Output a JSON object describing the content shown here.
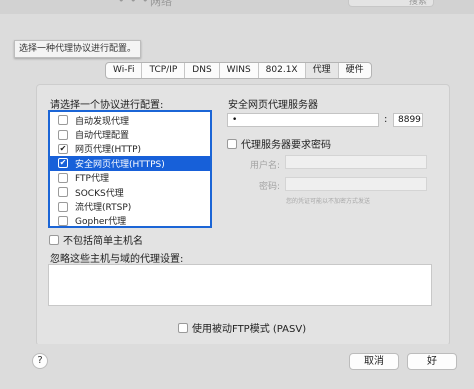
{
  "window": {
    "title_partial": "网络",
    "search_partial": "搜索"
  },
  "tooltip": "选择一种代理协议进行配置。",
  "tabs": [
    {
      "label": "Wi-Fi",
      "selected": false
    },
    {
      "label": "TCP/IP",
      "selected": false
    },
    {
      "label": "DNS",
      "selected": false
    },
    {
      "label": "WINS",
      "selected": false
    },
    {
      "label": "802.1X",
      "selected": false
    },
    {
      "label": "代理",
      "selected": true
    },
    {
      "label": "硬件",
      "selected": false
    }
  ],
  "protocol_section": {
    "label": "请选择一个协议进行配置:",
    "items": [
      {
        "label": "自动发现代理",
        "checked": false,
        "selected": false
      },
      {
        "label": "自动代理配置",
        "checked": false,
        "selected": false
      },
      {
        "label": "网页代理(HTTP)",
        "checked": true,
        "selected": false
      },
      {
        "label": "安全网页代理(HTTPS)",
        "checked": true,
        "selected": true
      },
      {
        "label": "FTP代理",
        "checked": false,
        "selected": false
      },
      {
        "label": "SOCKS代理",
        "checked": false,
        "selected": false
      },
      {
        "label": "流代理(RTSP)",
        "checked": false,
        "selected": false
      },
      {
        "label": "Gopher代理",
        "checked": false,
        "selected": false
      }
    ]
  },
  "server": {
    "label": "安全网页代理服务器",
    "address": "•",
    "separator": ":",
    "port": "8899",
    "requires_password_label": "代理服务器要求密码",
    "requires_password": false,
    "username_label": "用户名:",
    "password_label": "密码:",
    "hint": "您的凭证可能以不加密方式发送"
  },
  "exclude_simple_hostnames_label": "不包括简单主机名",
  "bypass": {
    "label": "忽略这些主机与域的代理设置:",
    "value": ""
  },
  "passive_ftp": {
    "label": "使用被动FTP模式 (PASV)",
    "checked": false
  },
  "buttons": {
    "help": "?",
    "cancel": "取消",
    "ok": "好"
  },
  "colors": {
    "selection": "#1760d9",
    "focus_ring": "#1b65d6"
  }
}
